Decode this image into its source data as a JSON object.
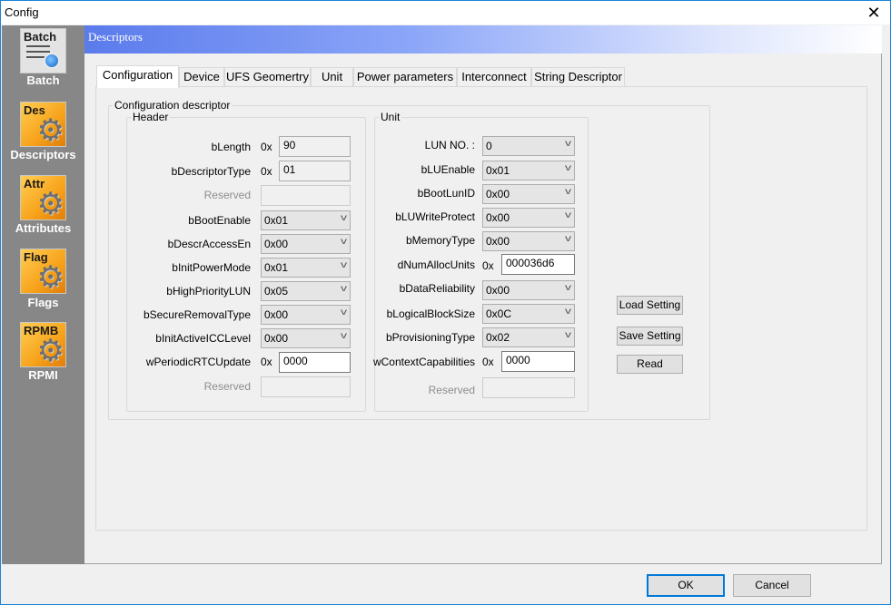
{
  "window": {
    "title": "Config",
    "close_icon": "close-icon"
  },
  "sidebar": {
    "items": [
      {
        "badge": "Batch",
        "label": "Batch",
        "icon": "batch-icon"
      },
      {
        "badge": "Des",
        "label": "Descriptors",
        "icon": "descriptors-gear-icon"
      },
      {
        "badge": "Attr",
        "label": "Attributes",
        "icon": "attributes-gear-icon"
      },
      {
        "badge": "Flag",
        "label": "Flags",
        "icon": "flags-gear-icon"
      },
      {
        "badge": "RPMB",
        "label": "RPMI",
        "icon": "rpmb-gear-icon"
      }
    ]
  },
  "header": {
    "title": "Descriptors"
  },
  "tabs": [
    {
      "label": "Configuration",
      "active": true
    },
    {
      "label": "Device"
    },
    {
      "label": "UFS Geomertry"
    },
    {
      "label": "Unit"
    },
    {
      "label": "Power parameters"
    },
    {
      "label": "Interconnect"
    },
    {
      "label": "String Descriptor"
    }
  ],
  "config": {
    "group_title": "Configuration descriptor",
    "header": {
      "title": "Header",
      "prefix": "0x",
      "fields": [
        {
          "label": "bLength",
          "type": "text-ro",
          "value": "90"
        },
        {
          "label": "bDescriptorType",
          "type": "text-ro",
          "value": "01"
        },
        {
          "label": "Reserved",
          "type": "disabled",
          "value": ""
        },
        {
          "label": "bBootEnable",
          "type": "combo",
          "value": "0x01"
        },
        {
          "label": "bDescrAccessEn",
          "type": "combo",
          "value": "0x00"
        },
        {
          "label": "bInitPowerMode",
          "type": "combo",
          "value": "0x01"
        },
        {
          "label": "bHighPriorityLUN",
          "type": "combo",
          "value": "0x05"
        },
        {
          "label": "bSecureRemovalType",
          "type": "combo",
          "value": "0x00"
        },
        {
          "label": "bInitActiveICCLevel",
          "type": "combo",
          "value": "0x00"
        },
        {
          "label": "wPeriodicRTCUpdate",
          "type": "text",
          "value": "0000"
        },
        {
          "label": "Reserved",
          "type": "disabled",
          "value": ""
        }
      ]
    },
    "unit": {
      "title": "Unit",
      "prefix": "0x",
      "fields": [
        {
          "label": "LUN NO. :",
          "type": "combo",
          "value": "0"
        },
        {
          "label": "bLUEnable",
          "type": "combo",
          "value": "0x01"
        },
        {
          "label": "bBootLunID",
          "type": "combo",
          "value": "0x00"
        },
        {
          "label": "bLUWriteProtect",
          "type": "combo",
          "value": "0x00"
        },
        {
          "label": "bMemoryType",
          "type": "combo",
          "value": "0x00"
        },
        {
          "label": "dNumAllocUnits",
          "type": "text",
          "value": "000036d6"
        },
        {
          "label": "bDataReliability",
          "type": "combo",
          "value": "0x00"
        },
        {
          "label": "bLogicalBlockSize",
          "type": "combo",
          "value": "0x0C"
        },
        {
          "label": "bProvisioningType",
          "type": "combo",
          "value": "0x02"
        },
        {
          "label": "wContextCapabilities",
          "type": "text",
          "value": "0000"
        },
        {
          "label": "Reserved",
          "type": "disabled",
          "value": ""
        }
      ]
    },
    "actions": {
      "load": "Load Setting",
      "save": "Save Setting",
      "read": "Read"
    }
  },
  "footer": {
    "ok": "OK",
    "cancel": "Cancel"
  }
}
